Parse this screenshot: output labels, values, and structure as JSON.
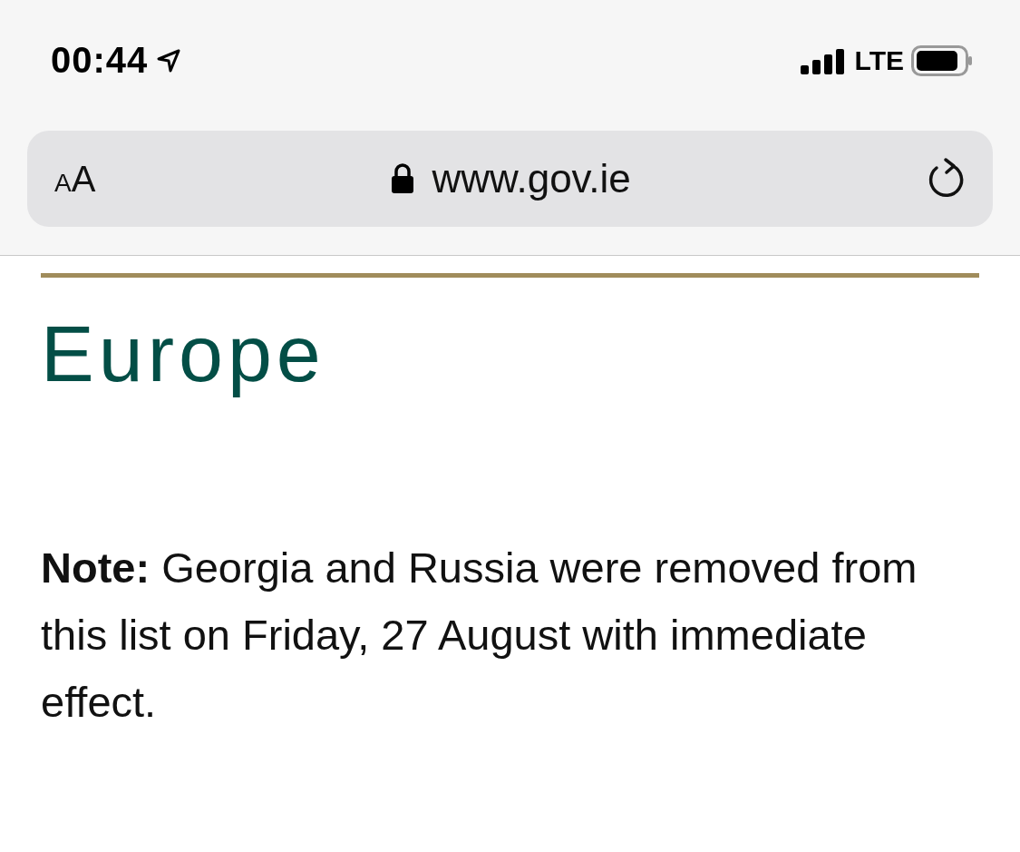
{
  "status_bar": {
    "time": "00:44",
    "network": "LTE"
  },
  "address_bar": {
    "reader_button": {
      "small": "A",
      "large": "A"
    },
    "url": "www.gov.ie"
  },
  "page": {
    "heading": "Europe",
    "note": "**Note:** Georgia and Russia were removed from this list on Friday, 27 August with immediate effect."
  }
}
